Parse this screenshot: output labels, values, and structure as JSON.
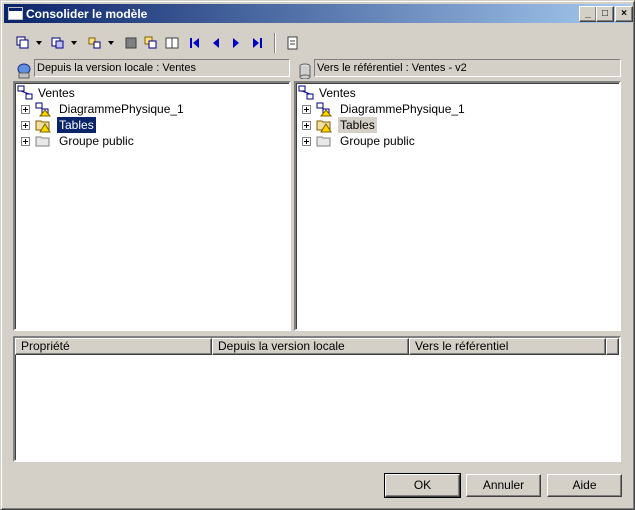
{
  "window": {
    "title": "Consolider le modèle"
  },
  "titlebar_buttons": {
    "minimize": "_",
    "maximize": "□",
    "close": "×"
  },
  "toolbar": {
    "icons": [
      "copy-icon",
      "paste-icon",
      "merge-icon",
      "square-icon",
      "replace-icon",
      "compare-icon",
      "first-icon",
      "previous-icon",
      "next-icon",
      "last-icon",
      "properties-icon"
    ]
  },
  "left_panel": {
    "header": "Depuis la version locale : Ventes",
    "tree": {
      "root": "Ventes",
      "children": [
        {
          "label": "DiagrammePhysique_1",
          "icon": "diagram-icon"
        },
        {
          "label": "Tables",
          "icon": "folder-warning-icon",
          "selected": true
        },
        {
          "label": "Groupe public",
          "icon": "folder-icon"
        }
      ]
    }
  },
  "right_panel": {
    "header": "Vers le référentiel : Ventes - v2",
    "tree": {
      "root": "Ventes",
      "children": [
        {
          "label": "DiagrammePhysique_1",
          "icon": "diagram-icon"
        },
        {
          "label": "Tables",
          "icon": "folder-warning-icon",
          "inactive_selected": true
        },
        {
          "label": "Groupe public",
          "icon": "folder-icon"
        }
      ]
    }
  },
  "property_list": {
    "columns": [
      "Propriété",
      "Depuis la version locale",
      "Vers le référentiel"
    ]
  },
  "buttons": {
    "ok": "OK",
    "cancel": "Annuler",
    "help": "Aide"
  },
  "colors": {
    "title_start": "#0a246a",
    "title_end": "#a6caf0",
    "face": "#d4d0c8",
    "selection": "#0a246a"
  }
}
